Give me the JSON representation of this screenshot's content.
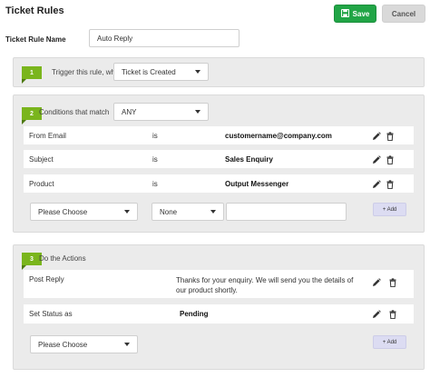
{
  "header": {
    "title": "Ticket Rules",
    "save_label": "Save",
    "cancel_label": "Cancel"
  },
  "rule_name": {
    "label": "Ticket Rule Name",
    "value": "Auto Reply"
  },
  "trigger": {
    "step": "1",
    "label": "Trigger this rule, when",
    "selected": "Ticket is Created"
  },
  "conditions": {
    "step": "2",
    "label": "Conditions that match",
    "match_selected": "ANY",
    "rows": [
      {
        "field": "From Email",
        "operator": "is",
        "value": "customername@company.com"
      },
      {
        "field": "Subject",
        "operator": "is",
        "value": "Sales Enquiry"
      },
      {
        "field": "Product",
        "operator": "is",
        "value": "Output Messenger"
      }
    ],
    "new_field_selected": "Please Choose",
    "new_operator_selected": "None",
    "new_value": "",
    "add_label": "+ Add"
  },
  "actions": {
    "step": "3",
    "label": "Do the Actions",
    "rows": [
      {
        "action": "Post Reply",
        "value": "Thanks for your enquiry. We will send you the details of our product shortly."
      },
      {
        "action": "Set Status as",
        "value": "Pending"
      }
    ],
    "new_action_selected": "Please Choose",
    "add_label": "+ Add"
  },
  "icons": {
    "edit": "pencil-icon",
    "delete": "trash-icon",
    "save": "save-disk-icon"
  },
  "colors": {
    "save": "#21a546",
    "step_badge": "#7ab51d",
    "add_button": "#dcdcf2",
    "cancel": "#d9d9d9"
  }
}
